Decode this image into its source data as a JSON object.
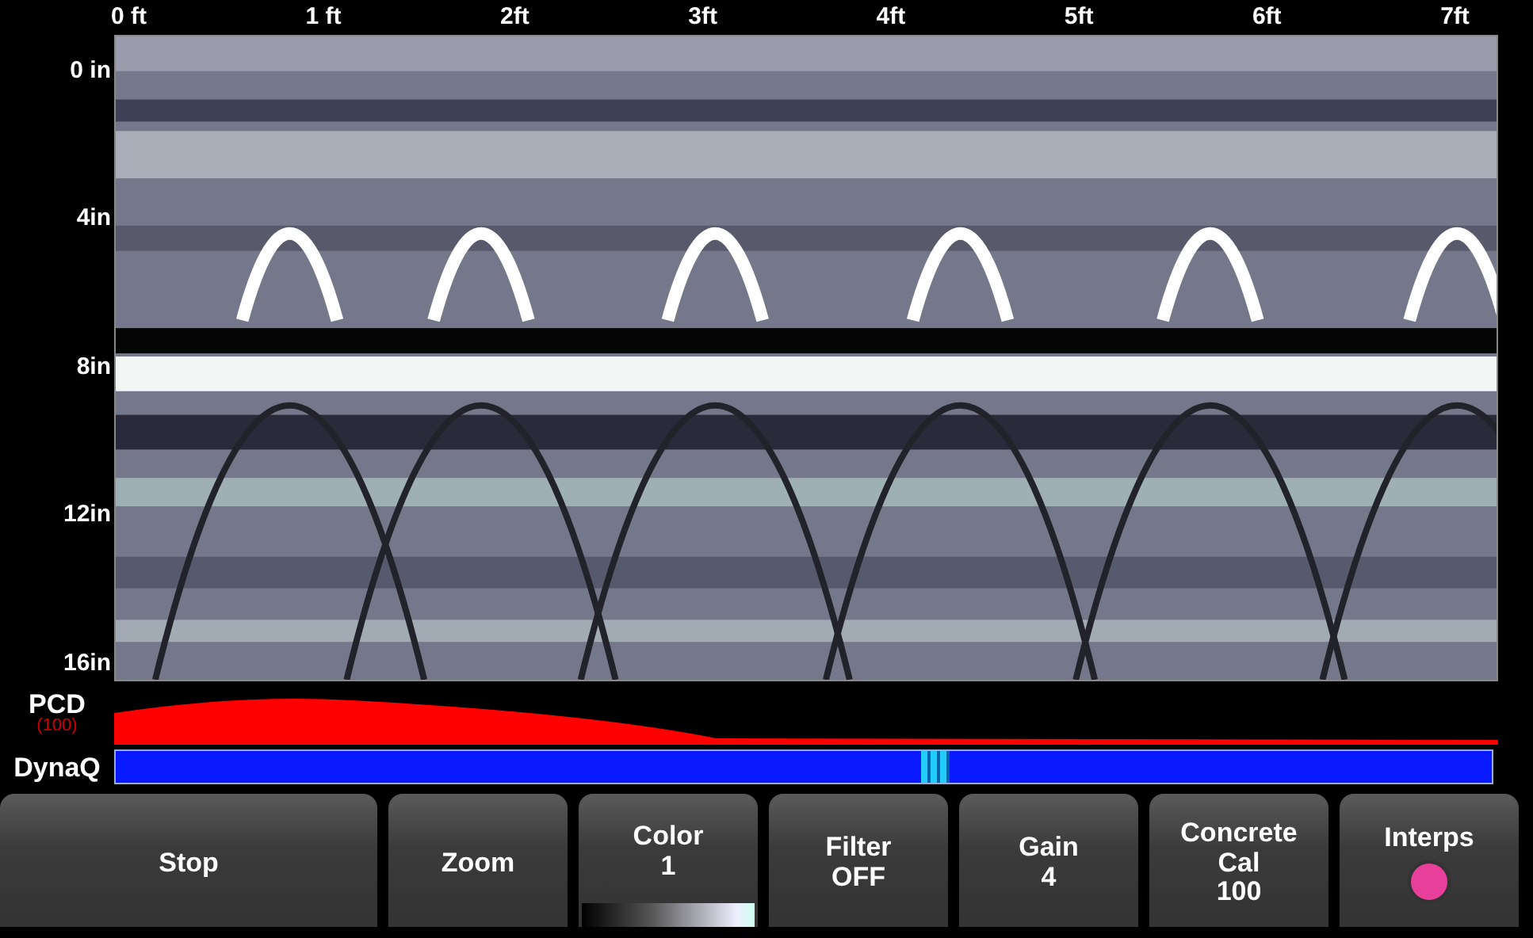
{
  "x_axis": {
    "labels": [
      "0 ft",
      "1 ft",
      "2ft",
      "3ft",
      "4ft",
      "5ft",
      "6ft",
      "7ft"
    ]
  },
  "y_axis": {
    "labels": [
      "0 in",
      "4in",
      "8in",
      "12in",
      "16in"
    ]
  },
  "pcd": {
    "label": "PCD",
    "value": "(100)"
  },
  "dynaq": {
    "label": "DynaQ"
  },
  "buttons": [
    {
      "kind": "plain",
      "lines": [
        "Stop"
      ]
    },
    {
      "kind": "plain",
      "lines": [
        "Zoom"
      ]
    },
    {
      "kind": "color-scale",
      "lines": [
        "Color",
        "1"
      ]
    },
    {
      "kind": "plain",
      "lines": [
        "Filter",
        "OFF"
      ]
    },
    {
      "kind": "plain",
      "lines": [
        "Gain",
        "4"
      ]
    },
    {
      "kind": "plain",
      "lines": [
        "Concrete",
        "Cal",
        "100"
      ]
    },
    {
      "kind": "indicator",
      "lines": [
        "Interps"
      ]
    }
  ]
}
